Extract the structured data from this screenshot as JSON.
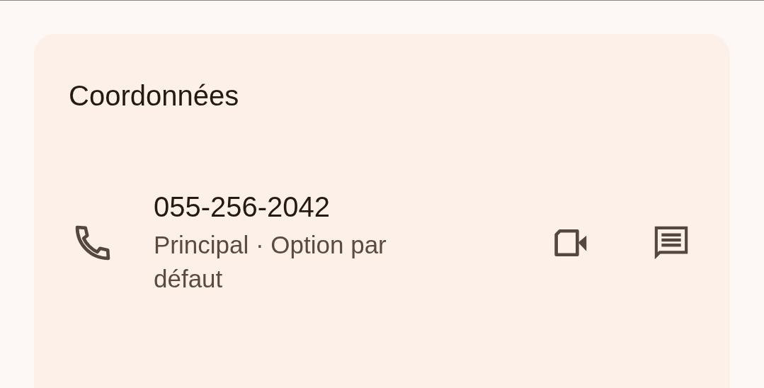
{
  "card": {
    "title": "Coordonnées",
    "contacts": [
      {
        "number": "055-256-2042",
        "label": "Principal · Option par défaut"
      }
    ]
  }
}
